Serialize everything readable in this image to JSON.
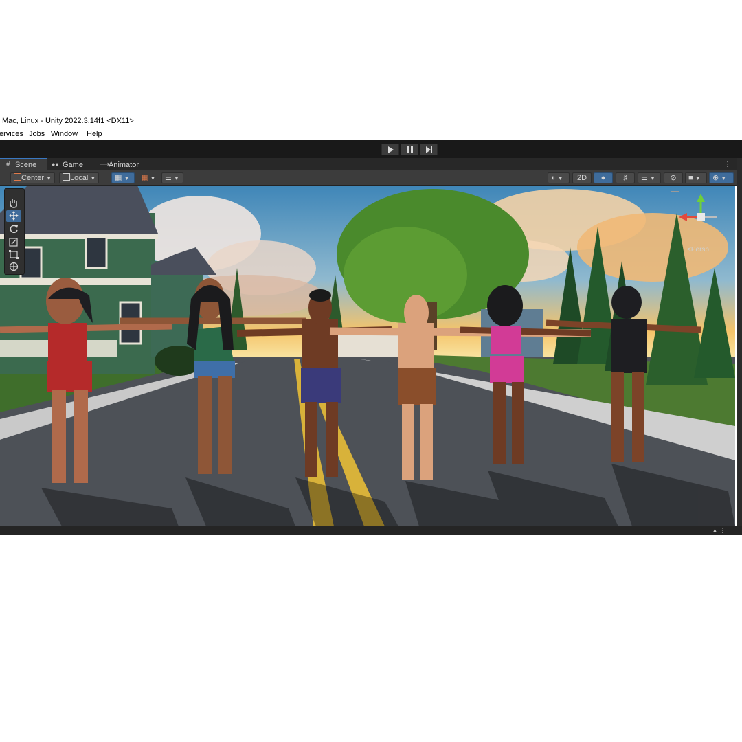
{
  "window": {
    "title": "Mac, Linux - Unity 2022.3.14f1 <DX11>"
  },
  "menu": {
    "items": [
      "ervices",
      "Jobs",
      "Window",
      "Help"
    ]
  },
  "playbar": {
    "buttons": [
      "play-icon",
      "pause-icon",
      "step-icon"
    ]
  },
  "tabs": [
    {
      "label": "Scene",
      "icon": "grid-icon",
      "active": true
    },
    {
      "label": "Game",
      "icon": "gamepad-icon",
      "active": false
    },
    {
      "label": "Animator",
      "icon": "animator-icon",
      "active": false
    }
  ],
  "scene_toolbar": {
    "pivot_label": "Center",
    "space_label": "Local",
    "mode_2d_label": "2D"
  },
  "scene": {
    "gizmo_label": "<Persp"
  },
  "colors": {
    "accent": "#3f6c9b",
    "editor_dark": "#191919",
    "panel": "#3c3c3c",
    "road": "#4d5157",
    "grass": "#3f6e2b",
    "sky_top": "#3f86b8",
    "sky_glow": "#f5c46a"
  }
}
